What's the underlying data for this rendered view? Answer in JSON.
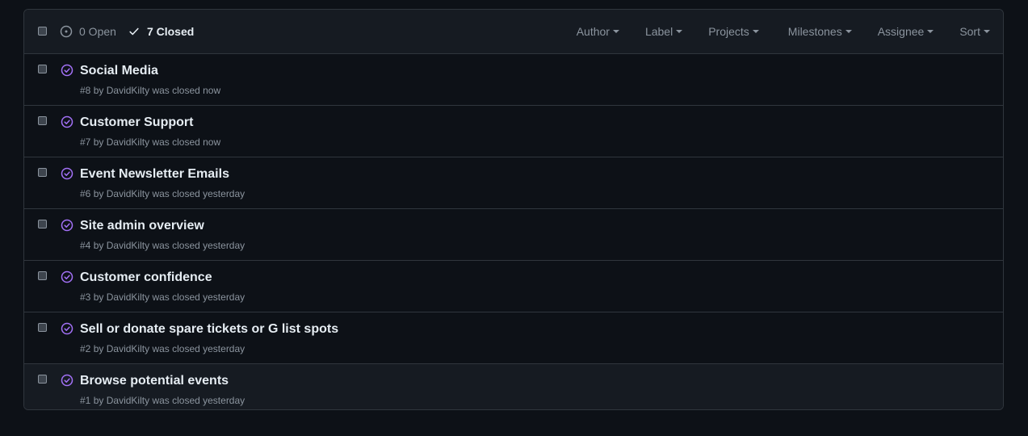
{
  "header": {
    "open_label": "0 Open",
    "closed_label": "7 Closed",
    "filters": [
      "Author",
      "Label",
      "Projects",
      "Milestones",
      "Assignee",
      "Sort"
    ]
  },
  "colors": {
    "closed_icon": "#a371f7",
    "background": "#0d1117",
    "header_bg": "#161b22",
    "border": "#30363d"
  },
  "issues": [
    {
      "title": "Social Media",
      "number": "#8",
      "by": "by",
      "author": "DavidKilty",
      "status": "was closed now"
    },
    {
      "title": "Customer Support",
      "number": "#7",
      "by": "by",
      "author": "DavidKilty",
      "status": "was closed now"
    },
    {
      "title": "Event Newsletter Emails",
      "number": "#6",
      "by": "by",
      "author": "DavidKilty",
      "status": "was closed yesterday"
    },
    {
      "title": "Site admin overview",
      "number": "#4",
      "by": "by",
      "author": "DavidKilty",
      "status": "was closed yesterday"
    },
    {
      "title": "Customer confidence",
      "number": "#3",
      "by": "by",
      "author": "DavidKilty",
      "status": "was closed yesterday"
    },
    {
      "title": "Sell or donate spare tickets or G list spots",
      "number": "#2",
      "by": "by",
      "author": "DavidKilty",
      "status": "was closed yesterday"
    },
    {
      "title": "Browse potential events",
      "number": "#1",
      "by": "by",
      "author": "DavidKilty",
      "status": "was closed yesterday"
    }
  ]
}
